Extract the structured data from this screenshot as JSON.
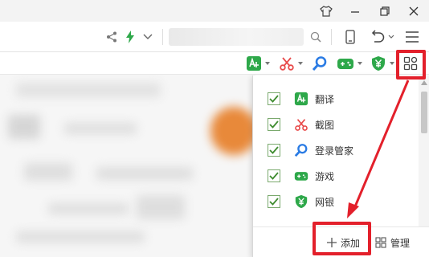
{
  "titlebar": {
    "icons": [
      "shirt-icon",
      "minimize-icon",
      "restore-icon",
      "close-icon"
    ]
  },
  "navbar": {
    "address_value": "",
    "icons": [
      "share-icon",
      "lightning-icon",
      "chevron-down-icon",
      "search-icon",
      "mobile-icon",
      "undo-icon",
      "menu-icon"
    ]
  },
  "extbar": {
    "items": [
      {
        "name": "translate",
        "color": "#2ea84a"
      },
      {
        "name": "screenshot",
        "color": "#e84a4a"
      },
      {
        "name": "search",
        "color": "#2a7be4"
      },
      {
        "name": "games",
        "color": "#2ea84a"
      },
      {
        "name": "banking",
        "color": "#2ea84a"
      }
    ],
    "apps_icon": "apps-grid-icon"
  },
  "menu": {
    "items": [
      {
        "label": "翻译",
        "checked": true,
        "icon": "translate-icon"
      },
      {
        "label": "截图",
        "checked": true,
        "icon": "scissors-icon"
      },
      {
        "label": "登录管家",
        "checked": true,
        "icon": "key-search-icon"
      },
      {
        "label": "游戏",
        "checked": true,
        "icon": "gamepad-icon"
      },
      {
        "label": "网银",
        "checked": true,
        "icon": "shield-yen-icon"
      }
    ],
    "add_label": "添加",
    "manage_label": "管理"
  },
  "annotation_color": "#e3202b"
}
